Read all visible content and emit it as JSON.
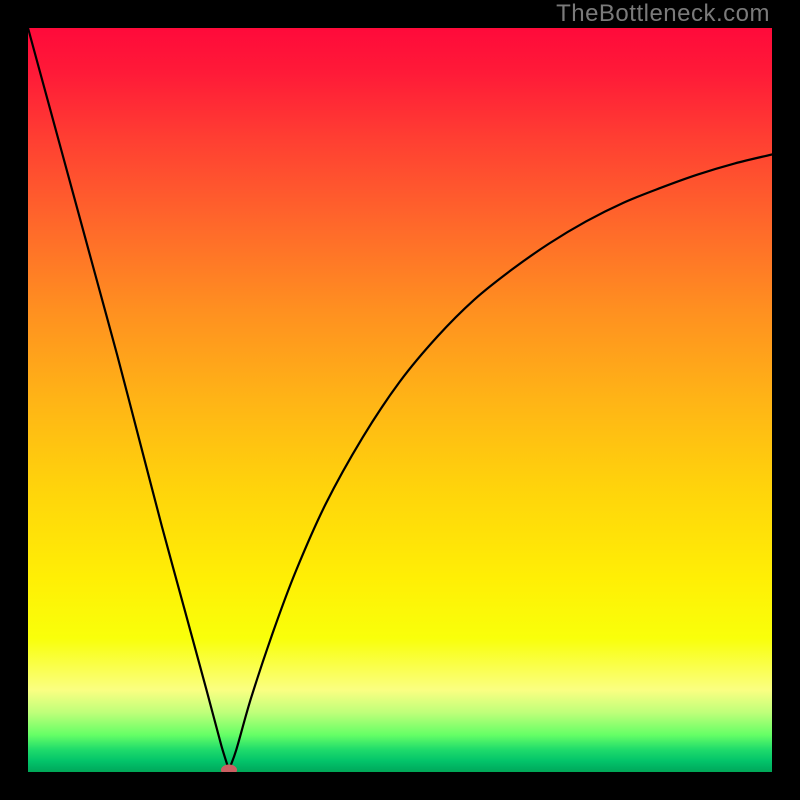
{
  "watermark": "TheBottleneck.com",
  "chart_data": {
    "type": "line",
    "title": "",
    "xlabel": "",
    "ylabel": "",
    "xlim": [
      0,
      100
    ],
    "ylim": [
      0,
      100
    ],
    "grid": false,
    "curve_min_x": 27,
    "series": [
      {
        "name": "bottleneck-curve",
        "x": [
          0,
          3,
          6,
          9,
          12,
          15,
          18,
          21,
          24,
          26,
          27,
          28,
          30,
          33,
          36,
          40,
          45,
          50,
          55,
          60,
          65,
          70,
          75,
          80,
          85,
          90,
          95,
          100
        ],
        "y": [
          100,
          89,
          78,
          67,
          56,
          44.5,
          33,
          22,
          11,
          3.5,
          0.3,
          3,
          10,
          19,
          27,
          36,
          45,
          52.5,
          58.5,
          63.5,
          67.5,
          71,
          74,
          76.5,
          78.5,
          80.3,
          81.8,
          83
        ]
      }
    ],
    "marker": {
      "x": 27,
      "y": 0.3,
      "name": "optimum-point"
    },
    "colors": {
      "curve": "#000000",
      "marker": "#cb5f62",
      "background_top": "#ff0a3a",
      "background_mid": "#ffd40b",
      "background_bottom": "#00a857",
      "frame": "#000000"
    }
  }
}
